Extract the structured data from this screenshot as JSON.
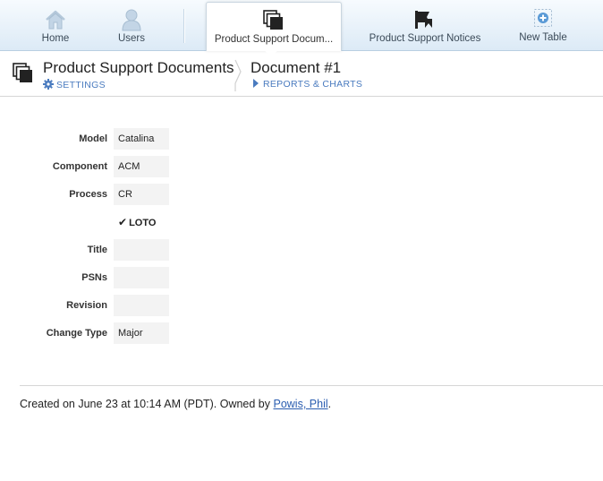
{
  "nav": {
    "items": [
      {
        "label": "Home",
        "icon": "home-icon"
      },
      {
        "label": "Users",
        "icon": "user-icon"
      },
      {
        "label": "Product Support Docum...",
        "icon": "documents-icon",
        "active": true
      },
      {
        "label": "Product Support Notices",
        "icon": "megaphone-icon"
      },
      {
        "label": "New Table",
        "icon": "add-table-icon"
      }
    ]
  },
  "header": {
    "app_title": "Product Support Documents",
    "settings_label": "SETTINGS",
    "doc_title": "Document #1",
    "reports_label": "REPORTS & CHARTS"
  },
  "form": {
    "fields": [
      {
        "label": "Model",
        "value": "Catalina"
      },
      {
        "label": "Component",
        "value": "ACM"
      },
      {
        "label": "Process",
        "value": "CR"
      },
      {
        "label": "",
        "value": "LOTO",
        "checked": true
      },
      {
        "label": "Title",
        "value": ""
      },
      {
        "label": "PSNs",
        "value": ""
      },
      {
        "label": "Revision",
        "value": ""
      },
      {
        "label": "Change Type",
        "value": "Major"
      }
    ]
  },
  "footer": {
    "prefix": "Created on June 23 at 10:14 AM (PDT). Owned by ",
    "owner": "Powis, Phil",
    "suffix": "."
  },
  "colors": {
    "link": "#4a7bbf",
    "nav_bg_top": "#f7fbfe",
    "nav_bg_bottom": "#dceaf6",
    "field_bg": "#f3f3f3"
  }
}
